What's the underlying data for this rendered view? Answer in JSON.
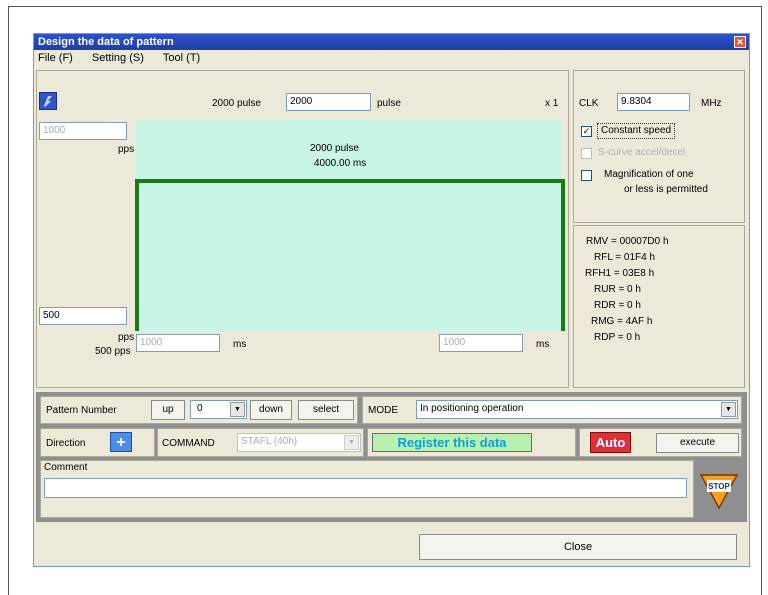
{
  "window": {
    "title": "Design the data of pattern",
    "close_glyph": "✕"
  },
  "menu": {
    "file": "File (F)",
    "setting": "Setting (S)",
    "tool": "Tool (T)"
  },
  "pulse": {
    "prefix": "2000 pulse",
    "value": "2000",
    "suffix": "pulse",
    "multiplier": "x 1"
  },
  "speed": {
    "top_value": "1000",
    "top_unit": "pps",
    "bottom_value": "500",
    "bottom_unit": "pps",
    "bottom_caption": "500 pps"
  },
  "graph": {
    "pulse_label": "2000 pulse",
    "time_label": "4000.00 ms"
  },
  "time": {
    "left_value": "1000",
    "left_unit": "ms",
    "right_value": "1000",
    "right_unit": "ms"
  },
  "clk": {
    "label": "CLK",
    "value": "9.8304",
    "unit": "MHz"
  },
  "options": {
    "constant_speed": "Constant speed",
    "s_curve": "S-curve accel/decel",
    "magnification_1": "Magnification of one",
    "magnification_2": "or less is permitted"
  },
  "registers": {
    "rmv": "RMV = 00007D0 h",
    "rfl": "RFL = 01F4 h",
    "rfh1": "RFH1 = 03E8 h",
    "rur": "RUR = 0 h",
    "rdr": "RDR = 0 h",
    "rmg": "RMG = 4AF h",
    "rdp": "RDP = 0 h"
  },
  "pattern": {
    "label": "Pattern Number",
    "up": "up",
    "value": "0",
    "down": "down",
    "select": "select"
  },
  "mode": {
    "label": "MODE",
    "value": "In positioning operation"
  },
  "direction": {
    "label": "Direction",
    "glyph": "+"
  },
  "command": {
    "label": "COMMAND",
    "value": "STAFL   (40h)"
  },
  "register_button": "Register this data",
  "auto_button": "Auto",
  "execute_button": "execute",
  "comment": {
    "label": "Comment",
    "value": ""
  },
  "stop_button": "STOP",
  "close_button": "Close",
  "colors": {
    "title_bar": "#1d3fa8",
    "graph_fill": "#c8f5e6",
    "graph_line": "#1a7a1a",
    "register_text": "#0a9fd8",
    "auto_red": "#e03030"
  }
}
